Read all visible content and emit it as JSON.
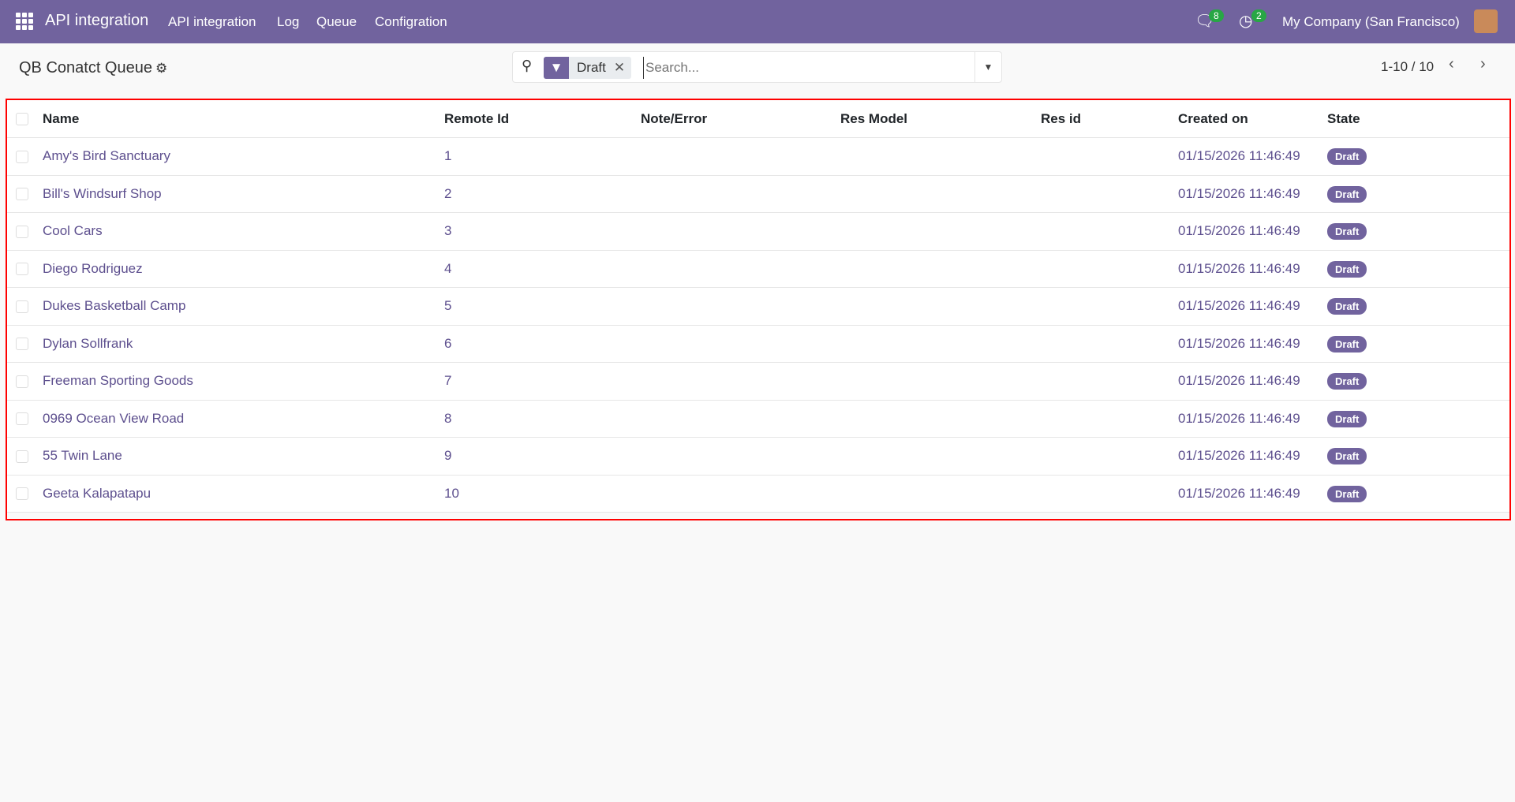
{
  "navbar": {
    "app_name": "API integration",
    "menu": [
      "API integration",
      "Log",
      "Queue",
      "Configration"
    ],
    "messages_count": "8",
    "activities_count": "2",
    "company": "My Company (San Francisco)"
  },
  "page": {
    "title": "QB Conatct Queue"
  },
  "search": {
    "facet": "Draft",
    "placeholder": "Search..."
  },
  "pager": {
    "range": "1-10 / 10"
  },
  "table": {
    "headers": [
      "Name",
      "Remote Id",
      "Note/Error",
      "Res Model",
      "Res id",
      "Created on",
      "State"
    ],
    "rows": [
      {
        "name": "Amy's Bird Sanctuary",
        "remote_id": "1",
        "created": "01/15/2026 11:46:49",
        "state": "Draft"
      },
      {
        "name": "Bill's Windsurf Shop",
        "remote_id": "2",
        "created": "01/15/2026 11:46:49",
        "state": "Draft"
      },
      {
        "name": "Cool Cars",
        "remote_id": "3",
        "created": "01/15/2026 11:46:49",
        "state": "Draft"
      },
      {
        "name": "Diego Rodriguez",
        "remote_id": "4",
        "created": "01/15/2026 11:46:49",
        "state": "Draft"
      },
      {
        "name": "Dukes Basketball Camp",
        "remote_id": "5",
        "created": "01/15/2026 11:46:49",
        "state": "Draft"
      },
      {
        "name": "Dylan Sollfrank",
        "remote_id": "6",
        "created": "01/15/2026 11:46:49",
        "state": "Draft"
      },
      {
        "name": "Freeman Sporting Goods",
        "remote_id": "7",
        "created": "01/15/2026 11:46:49",
        "state": "Draft"
      },
      {
        "name": "0969 Ocean View Road",
        "remote_id": "8",
        "created": "01/15/2026 11:46:49",
        "state": "Draft"
      },
      {
        "name": "55 Twin Lane",
        "remote_id": "9",
        "created": "01/15/2026 11:46:49",
        "state": "Draft"
      },
      {
        "name": "Geeta Kalapatapu",
        "remote_id": "10",
        "created": "01/15/2026 11:46:49",
        "state": "Draft"
      }
    ]
  }
}
